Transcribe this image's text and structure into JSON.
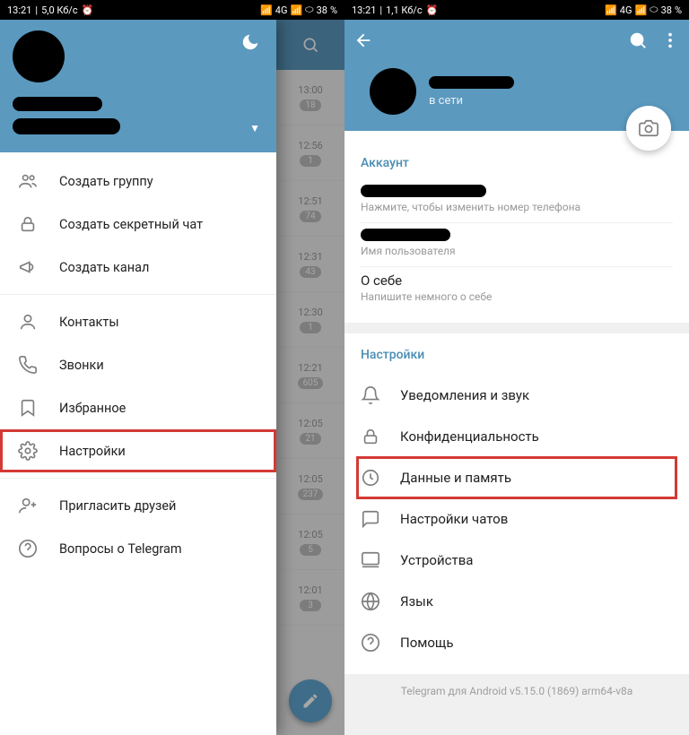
{
  "statusbar": {
    "left_time": "13:21",
    "left_net_speed_1": "5,0 Кб/с",
    "left_net_speed_2": "1,1 Кб/с",
    "battery": "38",
    "sig_label": "4G"
  },
  "drawer": {
    "items": [
      {
        "label": "Создать группу"
      },
      {
        "label": "Создать секретный чат"
      },
      {
        "label": "Создать канал"
      },
      {
        "label": "Контакты"
      },
      {
        "label": "Звонки"
      },
      {
        "label": "Избранное"
      },
      {
        "label": "Настройки"
      },
      {
        "label": "Пригласить друзей"
      },
      {
        "label": "Вопросы о Telegram"
      }
    ]
  },
  "chat_strip": [
    {
      "time": "13:00",
      "badge": "18"
    },
    {
      "time": "12:56",
      "badge": "1"
    },
    {
      "time": "12:51",
      "badge": "74"
    },
    {
      "time": "12:31",
      "badge": "43"
    },
    {
      "time": "12:30",
      "badge": "1"
    },
    {
      "time": "12:21",
      "badge": "605"
    },
    {
      "time": "12:05",
      "badge": "21"
    },
    {
      "time": "12:05",
      "badge": "237"
    },
    {
      "time": "12:05",
      "badge": "5"
    },
    {
      "time": "12:01",
      "badge": "3"
    }
  ],
  "profile": {
    "status": "в сети",
    "account_title": "Аккаунт",
    "phone_sub": "Нажмите, чтобы изменить номер телефона",
    "username_sub": "Имя пользователя",
    "about_main": "О себе",
    "about_sub": "Напишите немного о себе",
    "settings_title": "Настройки",
    "items": [
      {
        "label": "Уведомления и звук"
      },
      {
        "label": "Конфиденциальность"
      },
      {
        "label": "Данные и память"
      },
      {
        "label": "Настройки чатов"
      },
      {
        "label": "Устройства"
      },
      {
        "label": "Язык"
      },
      {
        "label": "Помощь"
      }
    ],
    "version": "Telegram для Android v5.15.0 (1869) arm64-v8a"
  }
}
